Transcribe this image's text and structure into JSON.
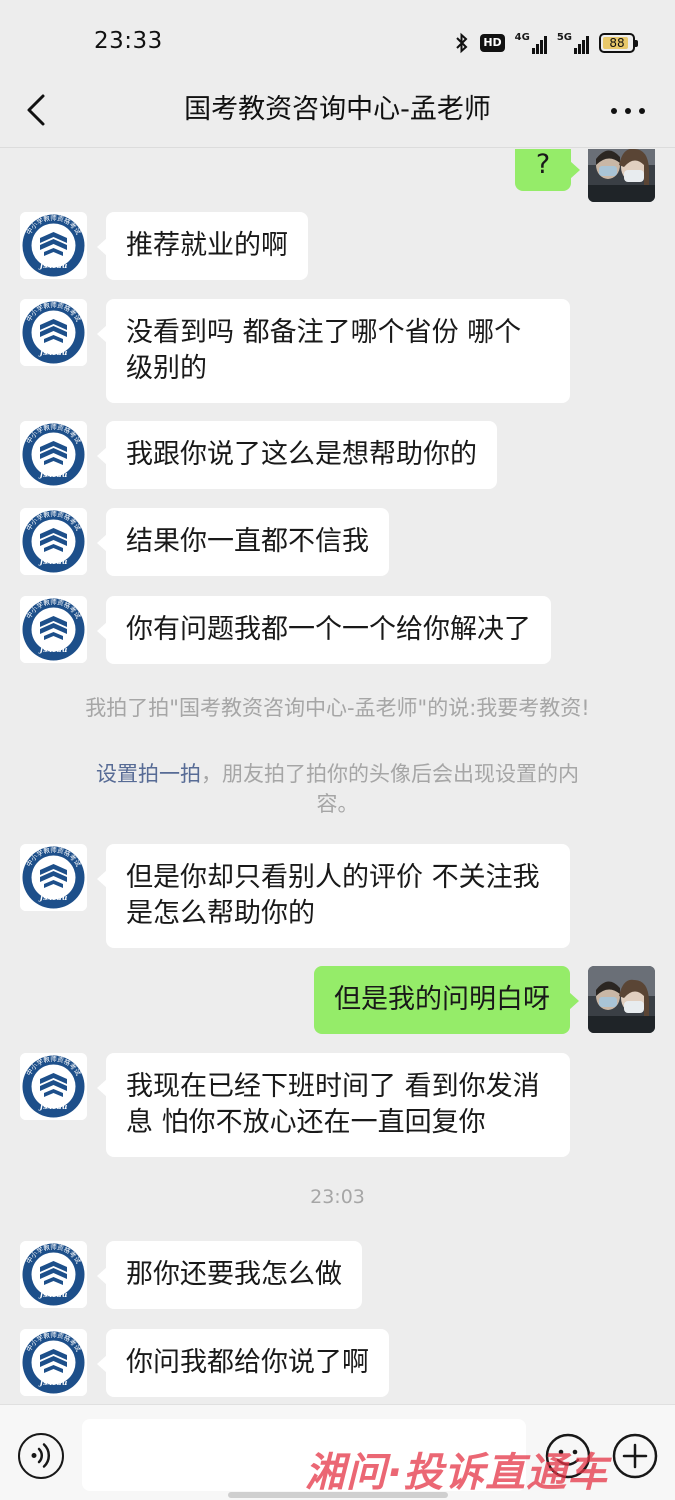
{
  "status_bar": {
    "time": "23:33",
    "hd_badge": "HD",
    "net1": "4G",
    "net2": "5G",
    "battery": "88",
    "battery_level": 0.88
  },
  "header": {
    "title": "国考教资咨询中心-孟老师"
  },
  "messages": [
    {
      "side": "right",
      "text": "?"
    },
    {
      "side": "left",
      "text": "推荐就业的啊"
    },
    {
      "side": "left",
      "lines": [
        "没看到吗 都备注了哪个省份 哪个",
        "级别的"
      ]
    },
    {
      "side": "left",
      "text": "我跟你说了这么是想帮助你的"
    },
    {
      "side": "left",
      "text": "结果你一直都不信我"
    },
    {
      "side": "left",
      "text": "你有问题我都一个一个给你解决了"
    },
    {
      "side": "left",
      "lines": [
        "但是你却只看别人的评价 不关注我",
        "是怎么帮助你的"
      ]
    },
    {
      "side": "right",
      "text": "但是我的问明白呀"
    },
    {
      "side": "left",
      "lines": [
        "我现在已经下班时间了 看到你发消",
        "息 怕你不放心还在一直回复你"
      ]
    },
    {
      "side": "left",
      "text": "那你还要我怎么做"
    },
    {
      "side": "left",
      "text": "你问我都给你说了啊"
    }
  ],
  "system": {
    "pat_notice": "我拍了拍\"国考教资咨询中心-孟老师\"的说:我要考教资!",
    "pat_link": "设置拍一拍",
    "pat_tip_line1": "，朋友拍了拍你的头像后会出现设置的内",
    "pat_tip_line2": "容。",
    "timestamp": "23:03"
  },
  "avatar": {
    "school_logo_text": "Jsxedu",
    "ring_text": "中小学教师资格考试"
  },
  "watermark": "湘问·投诉直通车",
  "colors": {
    "background": "#ededed",
    "sent_bubble": "#95ec69",
    "received_bubble": "#ffffff",
    "link": "#576b95",
    "system_text": "#a6a6a6",
    "logo_blue": "#1d4f8a"
  }
}
